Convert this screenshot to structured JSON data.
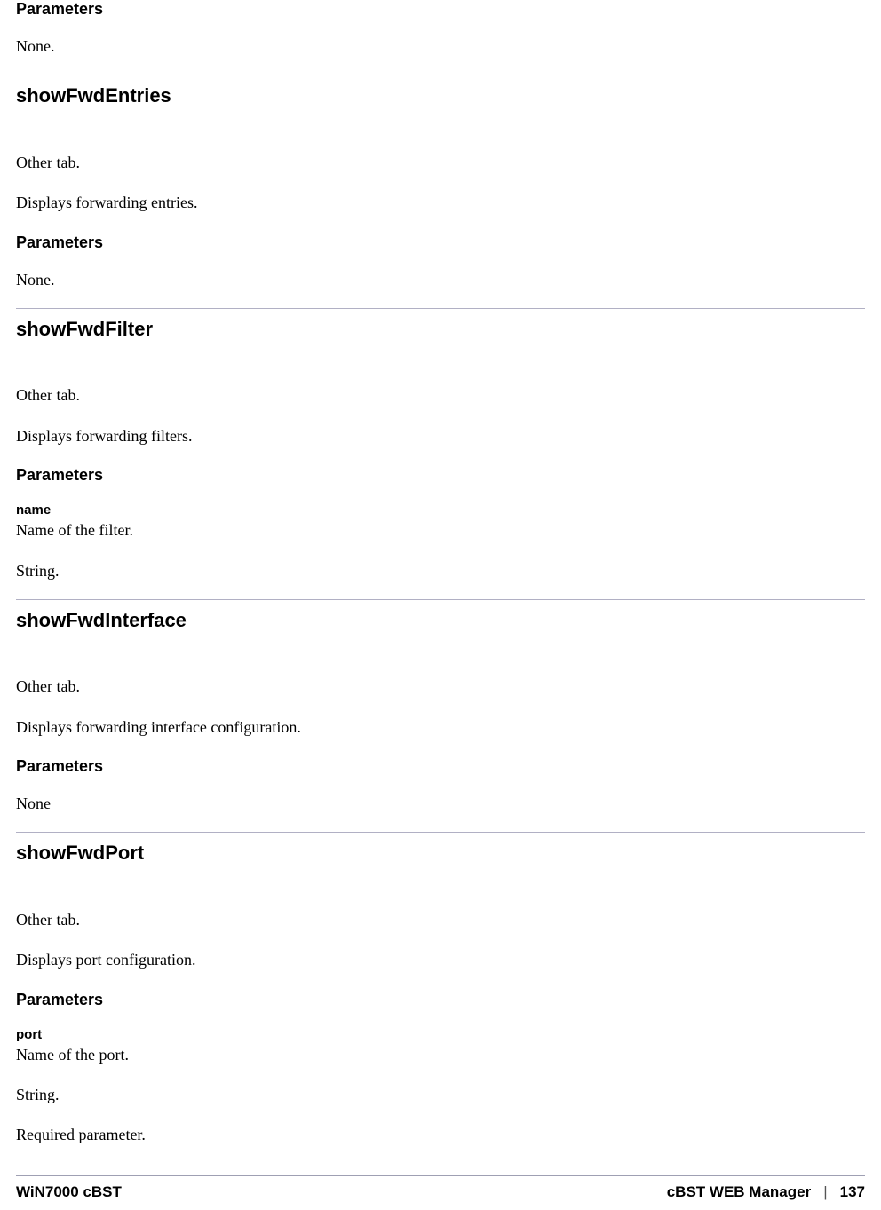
{
  "sections": [
    {
      "parameters_heading": "Parameters",
      "body": [
        "None."
      ]
    },
    {
      "title": "showFwdEntries",
      "desc": [
        "Other tab.",
        "Displays forwarding entries."
      ],
      "parameters_heading": "Parameters",
      "body": [
        "None."
      ]
    },
    {
      "title": "showFwdFilter",
      "desc": [
        "Other tab.",
        "Displays forwarding filters."
      ],
      "parameters_heading": "Parameters",
      "param_name": "name",
      "body": [
        "Name of the filter.",
        "String."
      ]
    },
    {
      "title": "showFwdInterface",
      "desc": [
        "Other tab.",
        "Displays forwarding interface configuration."
      ],
      "parameters_heading": "Parameters",
      "body": [
        "None"
      ]
    },
    {
      "title": "showFwdPort",
      "desc": [
        "Other tab.",
        "Displays port configuration."
      ],
      "parameters_heading": "Parameters",
      "param_name": "port",
      "body": [
        "Name of the port.",
        "String.",
        "Required parameter."
      ]
    }
  ],
  "footer": {
    "left": "WiN7000 cBST",
    "right": "cBST WEB Manager",
    "divider": "|",
    "page_number": "137"
  }
}
